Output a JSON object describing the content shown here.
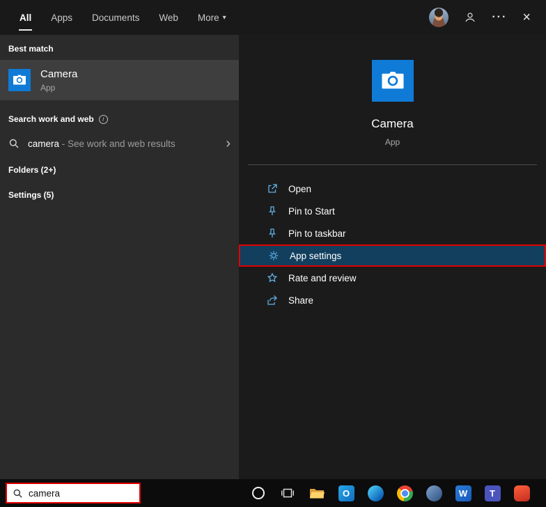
{
  "header": {
    "tabs": [
      {
        "label": "All",
        "active": true
      },
      {
        "label": "Apps",
        "active": false
      },
      {
        "label": "Documents",
        "active": false
      },
      {
        "label": "Web",
        "active": false
      },
      {
        "label": "More",
        "active": false
      }
    ],
    "more_caret": "▾",
    "ellipsis": "···",
    "close": "×"
  },
  "left_panel": {
    "best_match_label": "Best match",
    "best_match": {
      "title": "Camera",
      "subtitle": "App"
    },
    "search_web_label": "Search work and web",
    "info_symbol": "i",
    "web_search": {
      "query": "camera",
      "suffix": " - See work and web results",
      "chevron": "›"
    },
    "folders_label": "Folders (2+)",
    "settings_label": "Settings (5)"
  },
  "preview": {
    "app_name": "Camera",
    "app_type": "App",
    "actions": [
      {
        "label": "Open",
        "icon": "open-icon",
        "highlighted": false
      },
      {
        "label": "Pin to Start",
        "icon": "pin-icon",
        "highlighted": false
      },
      {
        "label": "Pin to taskbar",
        "icon": "pin-icon",
        "highlighted": false
      },
      {
        "label": "App settings",
        "icon": "gear-icon",
        "highlighted": true
      },
      {
        "label": "Rate and review",
        "icon": "star-icon",
        "highlighted": false
      },
      {
        "label": "Share",
        "icon": "share-icon",
        "highlighted": false
      }
    ]
  },
  "taskbar": {
    "search_value": "camera",
    "icons": [
      {
        "name": "cortana"
      },
      {
        "name": "task-view"
      },
      {
        "name": "file-explorer"
      },
      {
        "name": "outlook",
        "letter": "O"
      },
      {
        "name": "edge"
      },
      {
        "name": "chrome"
      },
      {
        "name": "app"
      },
      {
        "name": "word",
        "letter": "W"
      },
      {
        "name": "teams",
        "letter": "T"
      },
      {
        "name": "office"
      }
    ]
  },
  "colors": {
    "accent_blue": "#0f7bd7",
    "annotation_red": "#e10000",
    "highlight_row_blue": "#123f5e",
    "action_icon_blue": "#5fb2e8"
  }
}
